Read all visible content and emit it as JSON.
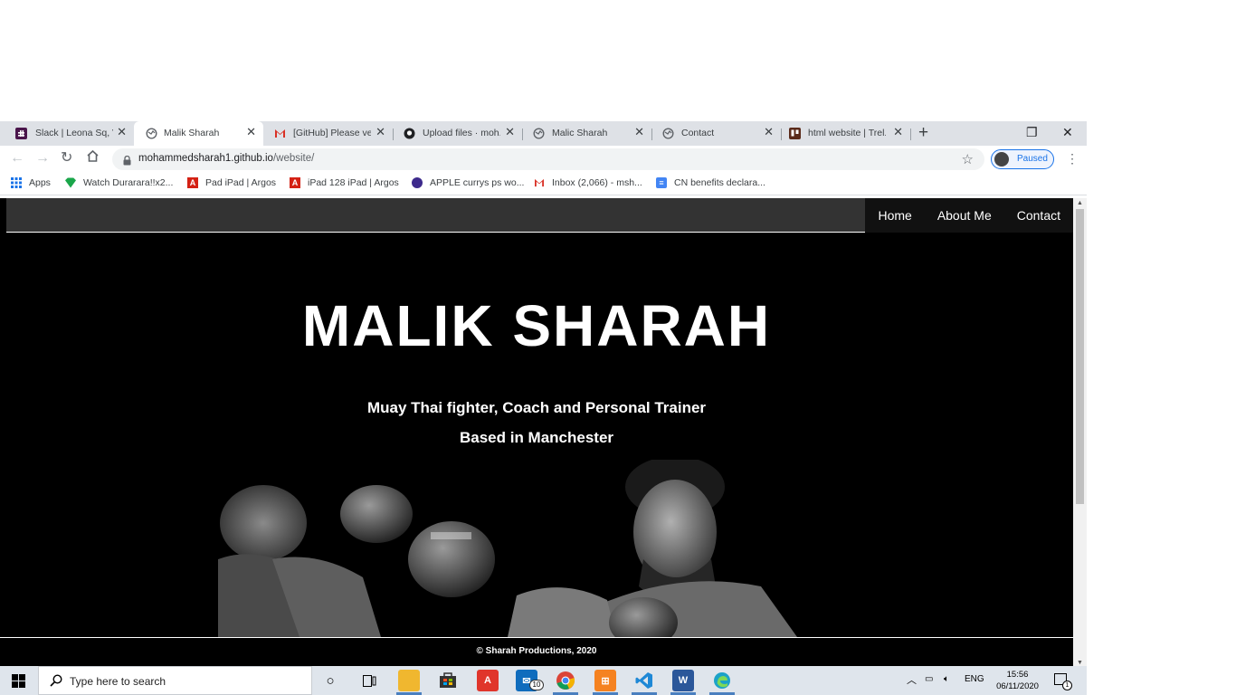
{
  "browser": {
    "tabs": [
      {
        "label": "Slack | Leona Sq, V...",
        "icon": "slack-icon",
        "active": false
      },
      {
        "label": "Malik Sharah",
        "icon": "globe-icon",
        "active": true
      },
      {
        "label": "[GitHub] Please ve...",
        "icon": "gmail-icon",
        "active": false
      },
      {
        "label": "Upload files · moh...",
        "icon": "github-icon",
        "active": false
      },
      {
        "label": "Malic Sharah",
        "icon": "globe-icon",
        "active": false
      },
      {
        "label": "Contact",
        "icon": "globe-icon",
        "active": false
      },
      {
        "label": "html website | Trel...",
        "icon": "trello-icon",
        "active": false
      }
    ],
    "url_domain": "mohammedsharah1.github.io",
    "url_path": "/website/",
    "profile_label": "Paused",
    "bookmarks": [
      {
        "label": "Apps",
        "icon": "apps-grid-icon"
      },
      {
        "label": "Watch Durarara!!x2...",
        "icon": "gem-icon"
      },
      {
        "label": "Pad iPad | Argos",
        "icon": "argos-icon"
      },
      {
        "label": "iPad 128 iPad | Argos",
        "icon": "argos-icon"
      },
      {
        "label": "APPLE currys ps wo...",
        "icon": "currys-icon"
      },
      {
        "label": "Inbox (2,066) - msh...",
        "icon": "gmail-icon"
      },
      {
        "label": "CN benefits declara...",
        "icon": "docs-icon"
      }
    ]
  },
  "site": {
    "nav": [
      "Home",
      "About Me",
      "Contact"
    ],
    "title": "MALIK SHARAH",
    "subtitle": "Muay Thai fighter, Coach and Personal Trainer",
    "location": "Based in Manchester",
    "footer": "© Sharah Productions, 2020"
  },
  "taskbar": {
    "search_placeholder": "Type here to search",
    "mail_badge": "10",
    "language": "ENG",
    "time": "15:56",
    "date": "06/11/2020",
    "notification_count": "1"
  },
  "colors": {
    "nav_bg": "#333333",
    "page_bg": "#000000",
    "accent_blue": "#1a73e8"
  }
}
